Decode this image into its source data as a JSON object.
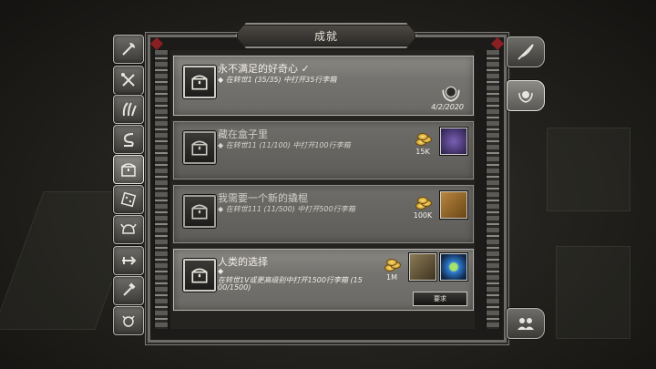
{
  "window": {
    "title": "成就"
  },
  "colors": {
    "accent": "#8a1f24",
    "panel": "#7c7b77",
    "text": "#f1eee6",
    "gold": "#e0b540"
  },
  "sidebar": {
    "tabs": [
      {
        "icon": "axe-icon"
      },
      {
        "icon": "tools-icon"
      },
      {
        "icon": "claw-icon"
      },
      {
        "icon": "snake-icon"
      },
      {
        "icon": "chest-icon",
        "active": true
      },
      {
        "icon": "dice-icon"
      },
      {
        "icon": "helmet-icon"
      },
      {
        "icon": "dagger-icon"
      },
      {
        "icon": "hammers-icon"
      },
      {
        "icon": "gear-bull-icon"
      }
    ]
  },
  "right_tabs": [
    {
      "icon": "quill-icon"
    },
    {
      "icon": "laurel-icon",
      "active": true
    },
    {
      "icon": "group-icon"
    }
  ],
  "achievements": [
    {
      "title": "永不满足的好奇心 ✓",
      "desc": "◆ 在转世1 (35/35) 中打开35行李箱",
      "date": "4/2/2020",
      "completed": true
    },
    {
      "title": "藏在盒子里",
      "desc": "◆ 在转世11 (11/100) 中打开100行李箱",
      "reward_gold": "15K",
      "completed": false
    },
    {
      "title": "我需要一个新的撬棍",
      "desc": "◆ 在转世111 (11/500) 中打开500行李箱",
      "reward_gold": "100K",
      "completed": false
    },
    {
      "title": "人类的选择",
      "desc_line1": "◆",
      "desc_line2": "在转世1V或更高级别中打开1500行李箱 (15",
      "desc_line3": "00/1500)",
      "reward_gold": "1M",
      "button": "要求",
      "completed": true
    }
  ]
}
